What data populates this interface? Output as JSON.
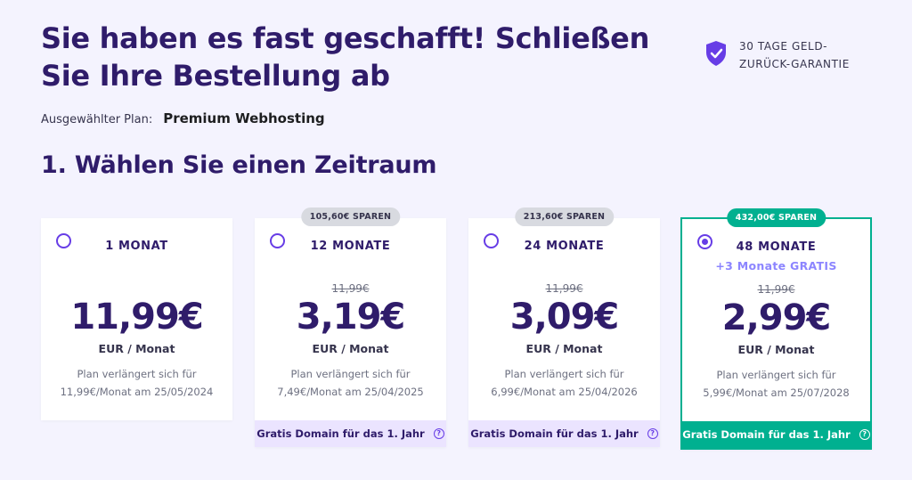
{
  "header": {
    "title": "Sie haben es fast geschafft! Schließen Sie Ihre Bestellung ab",
    "guarantee_line1": "30 TAGE GELD-",
    "guarantee_line2": "ZURÜCK-GARANTIE"
  },
  "plan": {
    "label": "Ausgewählter Plan:",
    "name": "Premium Webhosting"
  },
  "section": {
    "title": "1. Wählen Sie einen Zeitraum"
  },
  "cards": [
    {
      "period": "1 MONAT",
      "price": "11,99€",
      "unit": "EUR / Monat",
      "renew_line1": "Plan verlängert sich für",
      "renew_line2": "11,99€/Monat am 25/05/2024",
      "selected": false
    },
    {
      "badge": "105,60€ SPAREN",
      "period": "12 MONATE",
      "old_price": "11,99€",
      "price": "3,19€",
      "unit": "EUR / Monat",
      "renew_line1": "Plan verlängert sich für",
      "renew_line2": "7,49€/Monat am 25/04/2025",
      "domain": "Gratis Domain für das 1. Jahr",
      "selected": false
    },
    {
      "badge": "213,60€ SPAREN",
      "period": "24 MONATE",
      "old_price": "11,99€",
      "price": "3,09€",
      "unit": "EUR / Monat",
      "renew_line1": "Plan verlängert sich für",
      "renew_line2": "6,99€/Monat am 25/04/2026",
      "domain": "Gratis Domain für das 1. Jahr",
      "selected": false
    },
    {
      "badge": "432,00€ SPAREN",
      "period": "48 MONATE",
      "bonus": "+3 Monate GRATIS",
      "old_price": "11,99€",
      "price": "2,99€",
      "unit": "EUR / Monat",
      "renew_line1": "Plan verlängert sich für",
      "renew_line2": "5,99€/Monat am 25/07/2028",
      "domain": "Gratis Domain für das 1. Jahr",
      "selected": true
    }
  ],
  "icons": {
    "guarantee": "shield-check-icon",
    "help": "question-circle-icon"
  },
  "colors": {
    "background": "#f4f3fe",
    "primary_text": "#2f1c6a",
    "accent": "#673de6",
    "success": "#00b090",
    "domain_bar": "#ebe4ff"
  }
}
